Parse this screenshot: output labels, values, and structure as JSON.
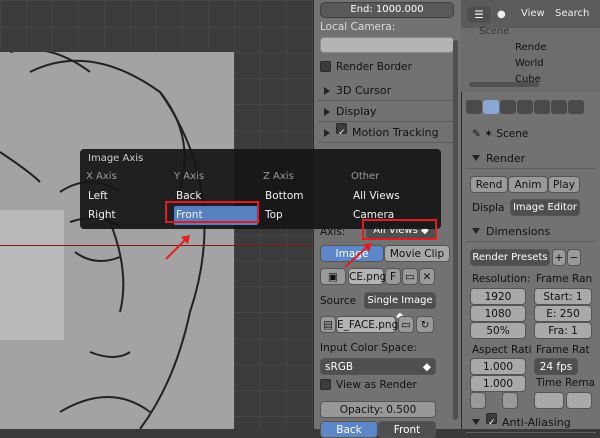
{
  "side_panel": {
    "end_frame": "End: 1000.000",
    "local_camera_label": "Local Camera:",
    "render_border": "Render Border",
    "cursor_3d": "3D Cursor",
    "display": "Display",
    "motion_tracking": "Motion Tracking",
    "axis_label": "Axis:",
    "axis_value": "All Views",
    "source_image": "Image",
    "source_movie": "Movie Clip",
    "image_name": "CE.png",
    "image_f": "F",
    "source_label": "Source",
    "source_value": "Single Image",
    "face_file": "E_FACE.png",
    "input_color_label": "Input Color Space:",
    "color_space": "sRGB",
    "view_as_render": "View as Render",
    "opacity": "Opacity: 0.500",
    "back": "Back",
    "front": "Front"
  },
  "popup": {
    "title": "Image Axis",
    "columns": [
      {
        "header": "X Axis",
        "items": [
          "Left",
          "Right"
        ]
      },
      {
        "header": "Y Axis",
        "items": [
          "Back",
          "Front"
        ]
      },
      {
        "header": "Z Axis",
        "items": [
          "Bottom",
          "Top"
        ]
      },
      {
        "header": "Other",
        "items": [
          "All Views",
          "Camera"
        ]
      }
    ],
    "selected": "Front"
  },
  "outliner": {
    "view": "View",
    "search": "Search",
    "items": [
      "Scene",
      "Rende",
      "World",
      "Cube"
    ]
  },
  "properties": {
    "scene": "Scene",
    "render_header": "Render",
    "render_btn": "Rend",
    "anim_btn": "Anim",
    "play_btn": "Play",
    "display_label": "Displa",
    "display_value": "Image Editor",
    "dimensions": "Dimensions",
    "render_presets": "Render Presets",
    "resolution": "Resolution:",
    "frame_range": "Frame Ran",
    "res_x": "1920",
    "res_y": "1080",
    "res_pct": "50%",
    "start": "Start: 1",
    "end": "E: 250",
    "frame": "Fra: 1",
    "aspect": "Aspect Rati",
    "frame_rate": "Frame Rat",
    "aspect_x": "1.000",
    "aspect_y": "1.000",
    "fps": "24 fps",
    "time_remap": "Time Rema",
    "anti_aliasing": "Anti-Aliasing"
  },
  "colors": {
    "selected": "#5680c2",
    "annotation": "#e21d22"
  }
}
